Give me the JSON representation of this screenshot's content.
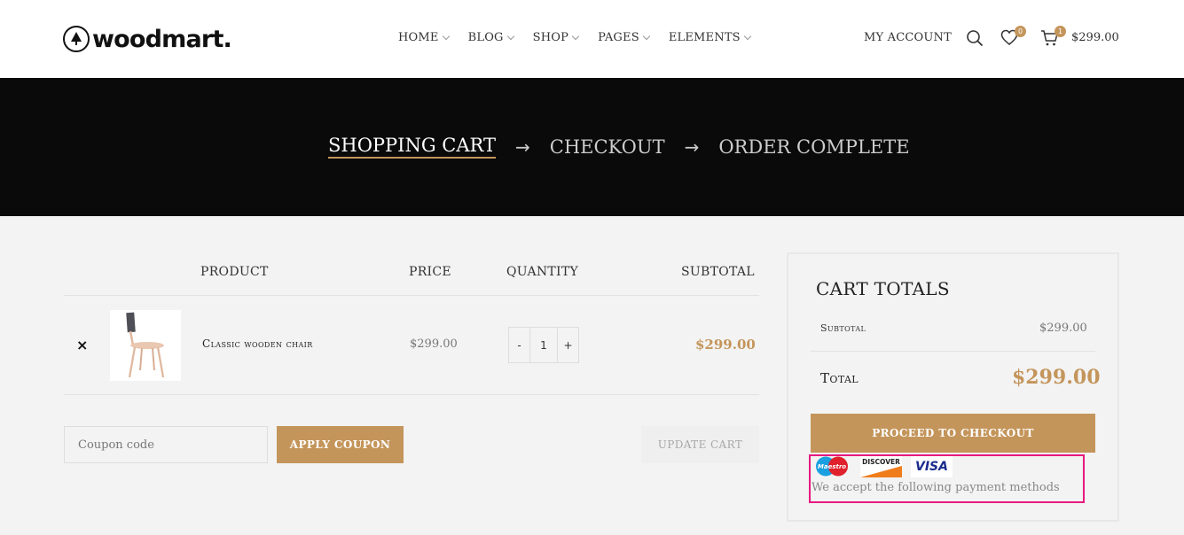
{
  "header": {
    "logo": "woodmart.",
    "nav": [
      {
        "label": "HOME"
      },
      {
        "label": "BLOG"
      },
      {
        "label": "SHOP"
      },
      {
        "label": "PAGES"
      },
      {
        "label": "ELEMENTS"
      }
    ],
    "my_account": "MY ACCOUNT",
    "wishlist_count": "0",
    "cart_count": "1",
    "cart_total": "$299.00"
  },
  "steps": {
    "cart": "SHOPPING CART",
    "checkout": "CHECKOUT",
    "complete": "ORDER COMPLETE",
    "arrow": "→"
  },
  "table": {
    "headers": {
      "product": "PRODUCT",
      "price": "PRICE",
      "quantity": "QUANTITY",
      "subtotal": "SUBTOTAL"
    },
    "rows": [
      {
        "name": "Classic wooden chair",
        "price": "$299.00",
        "qty": "1",
        "subtotal": "$299.00"
      }
    ]
  },
  "actions": {
    "coupon_placeholder": "Coupon code",
    "apply": "APPLY COUPON",
    "update": "UPDATE CART",
    "minus": "-",
    "plus": "+",
    "remove": "×"
  },
  "totals": {
    "title": "CART TOTALS",
    "subtotal_label": "Subtotal",
    "subtotal_value": "$299.00",
    "total_label": "Total",
    "total_value": "$299.00",
    "checkout": "PROCEED TO CHECKOUT",
    "payment_cards": [
      "Maestro",
      "DISCOVER",
      "VISA"
    ],
    "accept_text": "We accept the following payment methods"
  },
  "colors": {
    "accent": "#c4955b",
    "hero_bg": "#0a0a0a",
    "highlight": "#e6197e"
  }
}
